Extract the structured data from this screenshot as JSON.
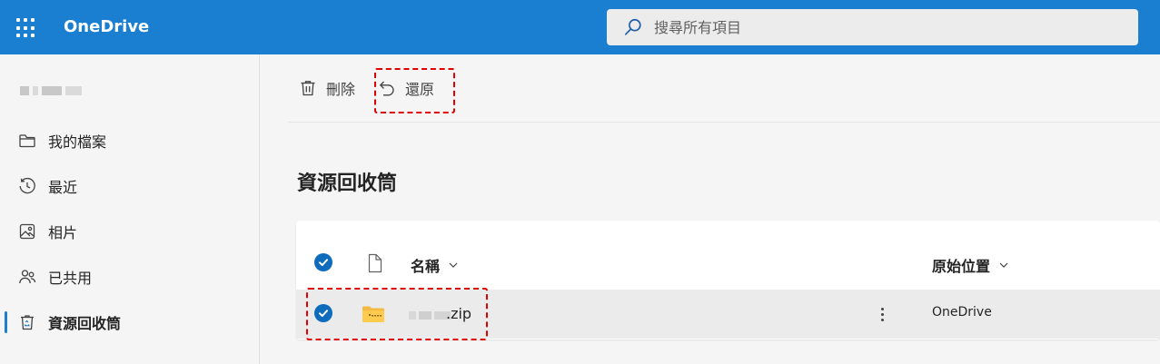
{
  "colors": {
    "brand": "#1a7fd1",
    "checkbox": "#0f6cbd",
    "highlight": "#e00000"
  },
  "header": {
    "app_title": "OneDrive",
    "search_placeholder": "搜尋所有項目",
    "waffle_icon": "app-launcher-icon",
    "search_icon": "search-icon"
  },
  "sidebar": {
    "items": [
      {
        "label": "我的檔案",
        "icon": "folder-icon"
      },
      {
        "label": "最近",
        "icon": "history-icon"
      },
      {
        "label": "相片",
        "icon": "photo-icon"
      },
      {
        "label": "已共用",
        "icon": "people-icon"
      },
      {
        "label": "資源回收筒",
        "icon": "recycle-bin-icon",
        "active": true
      }
    ]
  },
  "toolbar": {
    "delete_label": "刪除",
    "restore_label": "還原"
  },
  "page": {
    "title": "資源回收筒"
  },
  "table": {
    "columns": [
      {
        "label": "名稱"
      },
      {
        "label": "原始位置"
      }
    ],
    "rows": [
      {
        "name": ".zip",
        "location": "OneDrive",
        "selected": true
      }
    ]
  }
}
